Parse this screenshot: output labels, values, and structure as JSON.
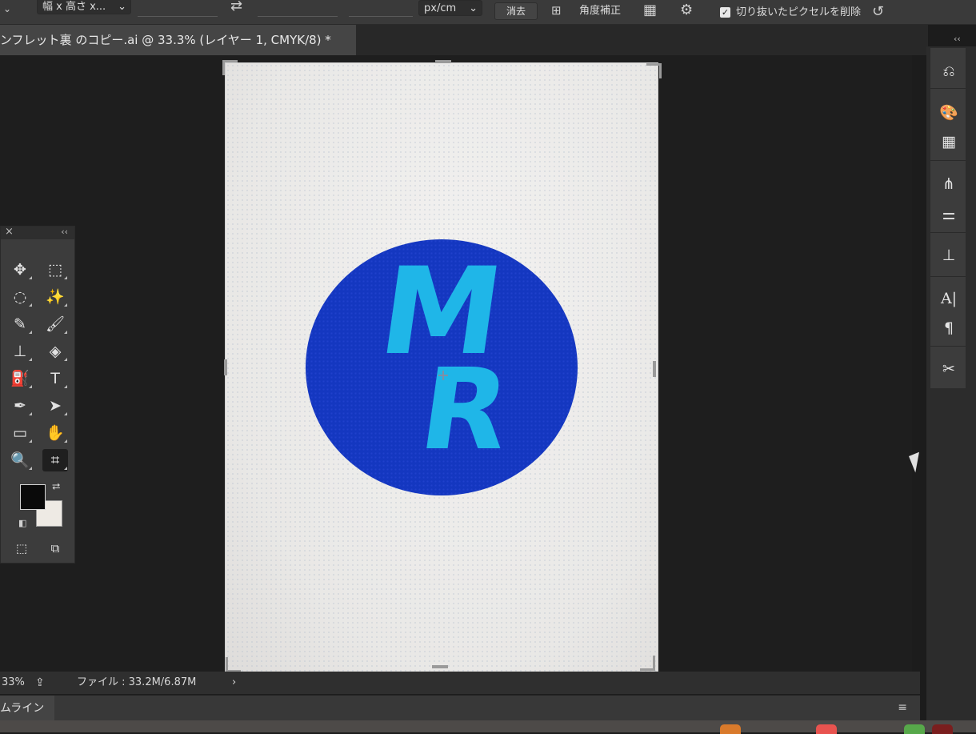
{
  "options_bar": {
    "ratio_dropdown": "幅 x 高さ x...",
    "units_dropdown": "px/cm",
    "clear_button": "消去",
    "straighten_label": "角度補正",
    "delete_cropped_label": "切り抜いたピクセルを削除",
    "delete_cropped_checked": true
  },
  "document": {
    "tab_title": "ンフレット裏 のコピー.ai @ 33.3% (レイヤー 1, CMYK/8) *"
  },
  "artwork": {
    "letter_top": "M",
    "letter_bottom": "R",
    "circle_color": "#1437c0",
    "letter_color": "#1fb6e8"
  },
  "tools": {
    "items": [
      {
        "name": "move-tool",
        "glyph": "✥"
      },
      {
        "name": "marquee-tool",
        "glyph": "⬚"
      },
      {
        "name": "lasso-tool",
        "glyph": "◌"
      },
      {
        "name": "magic-wand-tool",
        "glyph": "✨"
      },
      {
        "name": "eyedropper-tool",
        "glyph": "✎"
      },
      {
        "name": "brush-tool",
        "glyph": "🖌"
      },
      {
        "name": "stamp-tool",
        "glyph": "⊥"
      },
      {
        "name": "eraser-tool",
        "glyph": "◈"
      },
      {
        "name": "paint-bucket-tool",
        "glyph": "⛽"
      },
      {
        "name": "type-tool",
        "glyph": "T"
      },
      {
        "name": "pen-tool",
        "glyph": "✒"
      },
      {
        "name": "path-selection-tool",
        "glyph": "➤"
      },
      {
        "name": "rectangle-tool",
        "glyph": "▭"
      },
      {
        "name": "hand-tool",
        "glyph": "✋"
      },
      {
        "name": "zoom-tool",
        "glyph": "🔍"
      },
      {
        "name": "crop-tool",
        "glyph": "⌗"
      }
    ],
    "foreground_color": "#0a0a0a",
    "background_color": "#eeeae4"
  },
  "status": {
    "zoom": "33%",
    "file_info": "ファイル : 33.2M/6.87M",
    "timeline_tab": "ムライン"
  }
}
